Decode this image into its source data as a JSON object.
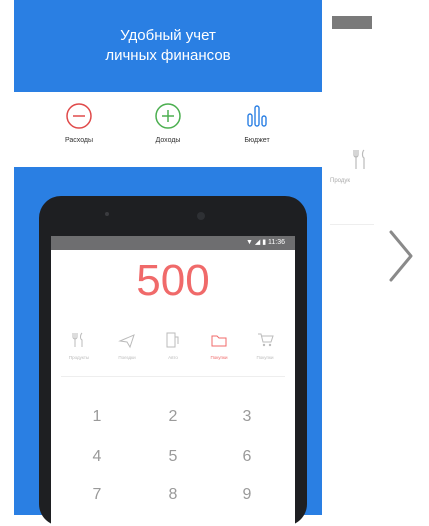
{
  "banner": {
    "line1": "Удобный учет",
    "line2": "личных финансов"
  },
  "features": [
    {
      "label": "Расходы",
      "icon": "minus-circle-icon",
      "color": "#e04a4a"
    },
    {
      "label": "Доходы",
      "icon": "plus-circle-icon",
      "color": "#4caf50"
    },
    {
      "label": "Бюджет",
      "icon": "bars-icon",
      "color": "#2a7fe3"
    }
  ],
  "phone": {
    "status_time": "▼ ◢ ▮ 11:36",
    "amount": "500",
    "categories": [
      {
        "label": "Продукты",
        "icon": "fork-knife-icon"
      },
      {
        "label": "Поездки",
        "icon": "plane-icon"
      },
      {
        "label": "Авто",
        "icon": "fuel-icon"
      },
      {
        "label": "Покупки",
        "icon": "folder-icon"
      },
      {
        "label": "Покупки",
        "icon": "cart-icon"
      }
    ],
    "active_category": 3,
    "keys": [
      "1",
      "2",
      "3",
      "4",
      "5",
      "6",
      "7",
      "8",
      "9"
    ]
  },
  "peek": {
    "text": "Продук"
  },
  "colors": {
    "brand_blue": "#2a7fe3",
    "accent_red": "#f06a6a",
    "accent_green": "#4caf50"
  }
}
